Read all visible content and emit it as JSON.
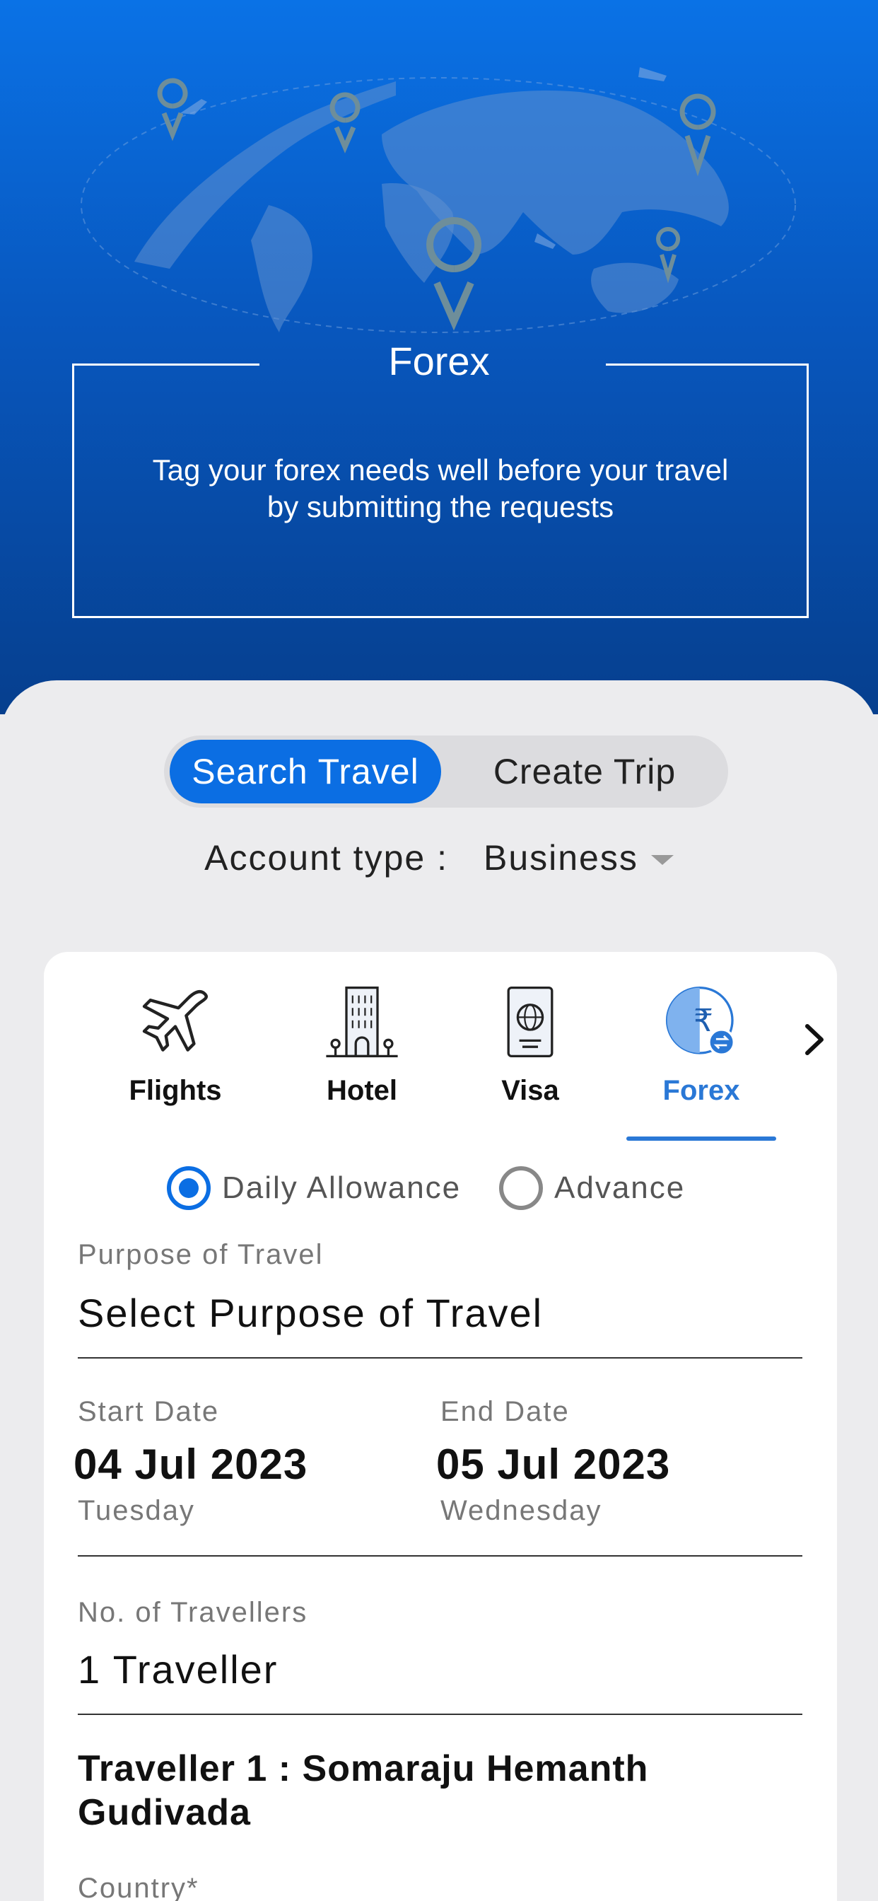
{
  "hero": {
    "title": "Forex",
    "description_line1": "Tag your forex needs well before your travel",
    "description_line2": "by submitting the requests"
  },
  "toggle": {
    "active": "Search Travel",
    "inactive": "Create Trip"
  },
  "account": {
    "label": "Account type :",
    "value": "Business"
  },
  "tabs": [
    {
      "label": "Flights",
      "icon": "airplane-icon"
    },
    {
      "label": "Hotel",
      "icon": "hotel-icon"
    },
    {
      "label": "Visa",
      "icon": "passport-icon"
    },
    {
      "label": "Forex",
      "icon": "rupee-exchange-icon",
      "active": true
    }
  ],
  "allowance": {
    "option1": "Daily Allowance",
    "option2": "Advance",
    "selected": "Daily Allowance"
  },
  "purpose": {
    "label": "Purpose of Travel",
    "value": "Select Purpose of Travel"
  },
  "dates": {
    "start_label": "Start Date",
    "start_value": "04 Jul 2023",
    "start_day": "Tuesday",
    "end_label": "End Date",
    "end_value": "05 Jul 2023",
    "end_day": "Wednesday"
  },
  "travellers": {
    "label": "No. of Travellers",
    "value": "1 Traveller"
  },
  "traveller1": {
    "name": "Traveller 1 : Somaraju Hemanth Gudivada",
    "country_label": "Country*"
  },
  "colors": {
    "accent": "#0B6EE3",
    "tab_active": "#2A78D6",
    "hero_top": "#0A72E6",
    "hero_bottom": "#063F8E"
  }
}
